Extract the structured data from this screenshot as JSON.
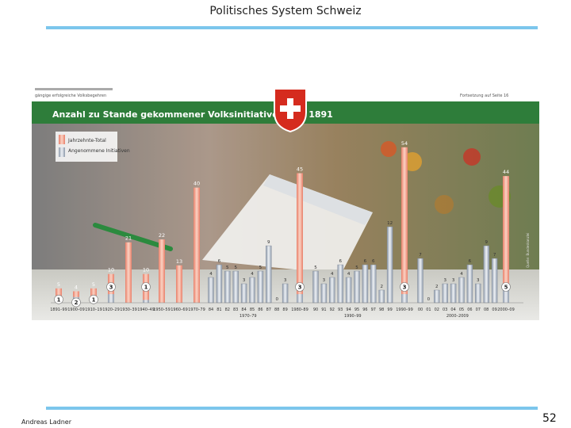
{
  "slide": {
    "title": "Politisches System Schweiz",
    "author": "Andreas Ladner",
    "page_number": "52"
  },
  "colors": {
    "rule": "#7cc6ec",
    "header_green": "#2e7d3a",
    "total_bar": "#f2a08c",
    "accepted_bar": "#b9c4d3",
    "swiss_red": "#d52b1e"
  },
  "icons": [
    "swiss-cross-icon"
  ],
  "chart_data": {
    "type": "bar",
    "title": "Anzahl zu Stande gekommener Volksinitiativen seit 1891",
    "legend": [
      "Jahrzehnte-Total",
      "Angenommene Initiativen"
    ],
    "legend_position": "top-left",
    "decade_bars": [
      {
        "label": "1891–99",
        "total": 5,
        "accepted": 1
      },
      {
        "label": "1900–09",
        "total": 4,
        "accepted": 2
      },
      {
        "label": "1910–19",
        "total": 5,
        "accepted": 1
      },
      {
        "label": "1920–29",
        "total": 10,
        "accepted": 3
      },
      {
        "label": "1930–39",
        "total": 21,
        "accepted": null
      },
      {
        "label": "1940–49",
        "total": 10,
        "accepted": 1
      },
      {
        "label": "1950–59",
        "total": 22,
        "accepted": null
      },
      {
        "label": "1960–69",
        "total": 13,
        "accepted": null
      },
      {
        "label": "1970–79",
        "total": 40,
        "accepted": null
      },
      {
        "label": "1980–89",
        "total": 45,
        "accepted": 3
      },
      {
        "label": "1990–99",
        "total": 54,
        "accepted": 3
      },
      {
        "label": "2000–09",
        "total": 44,
        "accepted": 5
      }
    ],
    "year_groups": [
      {
        "decade": "1970–79",
        "years": [
          "84",
          "81",
          "82",
          "83",
          "84",
          "85",
          "86",
          "87",
          "88",
          "89"
        ],
        "values": [
          4,
          6,
          5,
          5,
          3,
          4,
          5,
          9,
          0,
          3
        ]
      },
      {
        "decade": "1990–99",
        "years": [
          "90",
          "91",
          "92",
          "93",
          "94",
          "95",
          "96",
          "97",
          "98",
          "99"
        ],
        "values": [
          5,
          3,
          4,
          6,
          4,
          5,
          6,
          6,
          2,
          12
        ]
      },
      {
        "decade": "2000–2009",
        "years": [
          "00",
          "01",
          "02",
          "03",
          "04",
          "05",
          "06",
          "07",
          "08",
          "09"
        ],
        "values": [
          7,
          0,
          2,
          3,
          3,
          4,
          6,
          3,
          9,
          7
        ]
      }
    ],
    "header_left_line": "gängige erfolgreiche Volksbegehren",
    "header_right_line": "Fortsetzung auf Seite 16",
    "ylim": [
      0,
      60
    ],
    "grid": false
  }
}
